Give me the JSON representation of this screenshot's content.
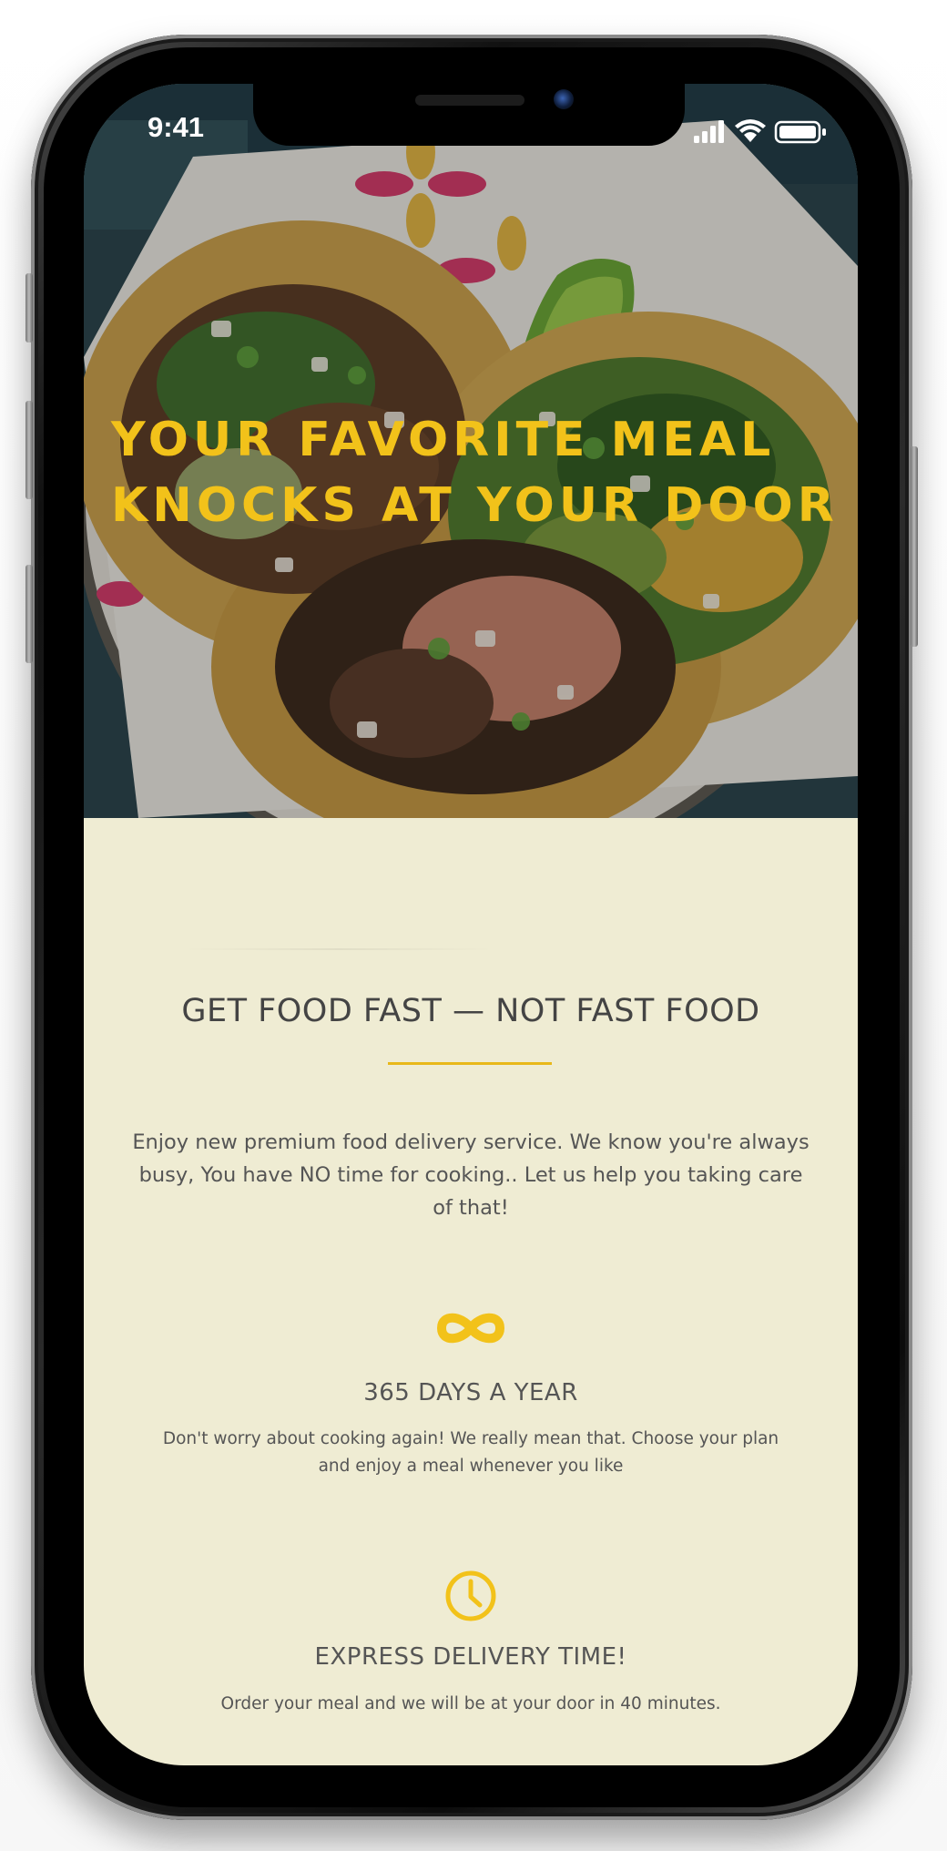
{
  "status_bar": {
    "time": "9:41",
    "icons": [
      "cellular-signal-icon",
      "wifi-icon",
      "battery-icon"
    ]
  },
  "hero": {
    "title_line1": "YOUR FAVORITE MEAL",
    "title_line2": "KNOCKS AT YOUR DOOR",
    "image": "tacos-plate-photo"
  },
  "about": {
    "title": "GET FOOD FAST — NOT FAST FOOD",
    "text": "Enjoy new premium food delivery service. We know you're always busy, You have NO time for cooking.. Let us help you taking care of that!"
  },
  "features": [
    {
      "icon": "infinity-icon",
      "title": "365 DAYS A YEAR",
      "text": "Don't worry about cooking again! We really mean that. Choose your plan and enjoy a meal whenever you like"
    },
    {
      "icon": "clock-icon",
      "title": "EXPRESS DELIVERY TIME!",
      "text": "Order your meal and we will be at your door in 40 minutes."
    }
  ],
  "colors": {
    "accent": "#f2c21a",
    "background": "#efecd3",
    "text": "#555555"
  }
}
